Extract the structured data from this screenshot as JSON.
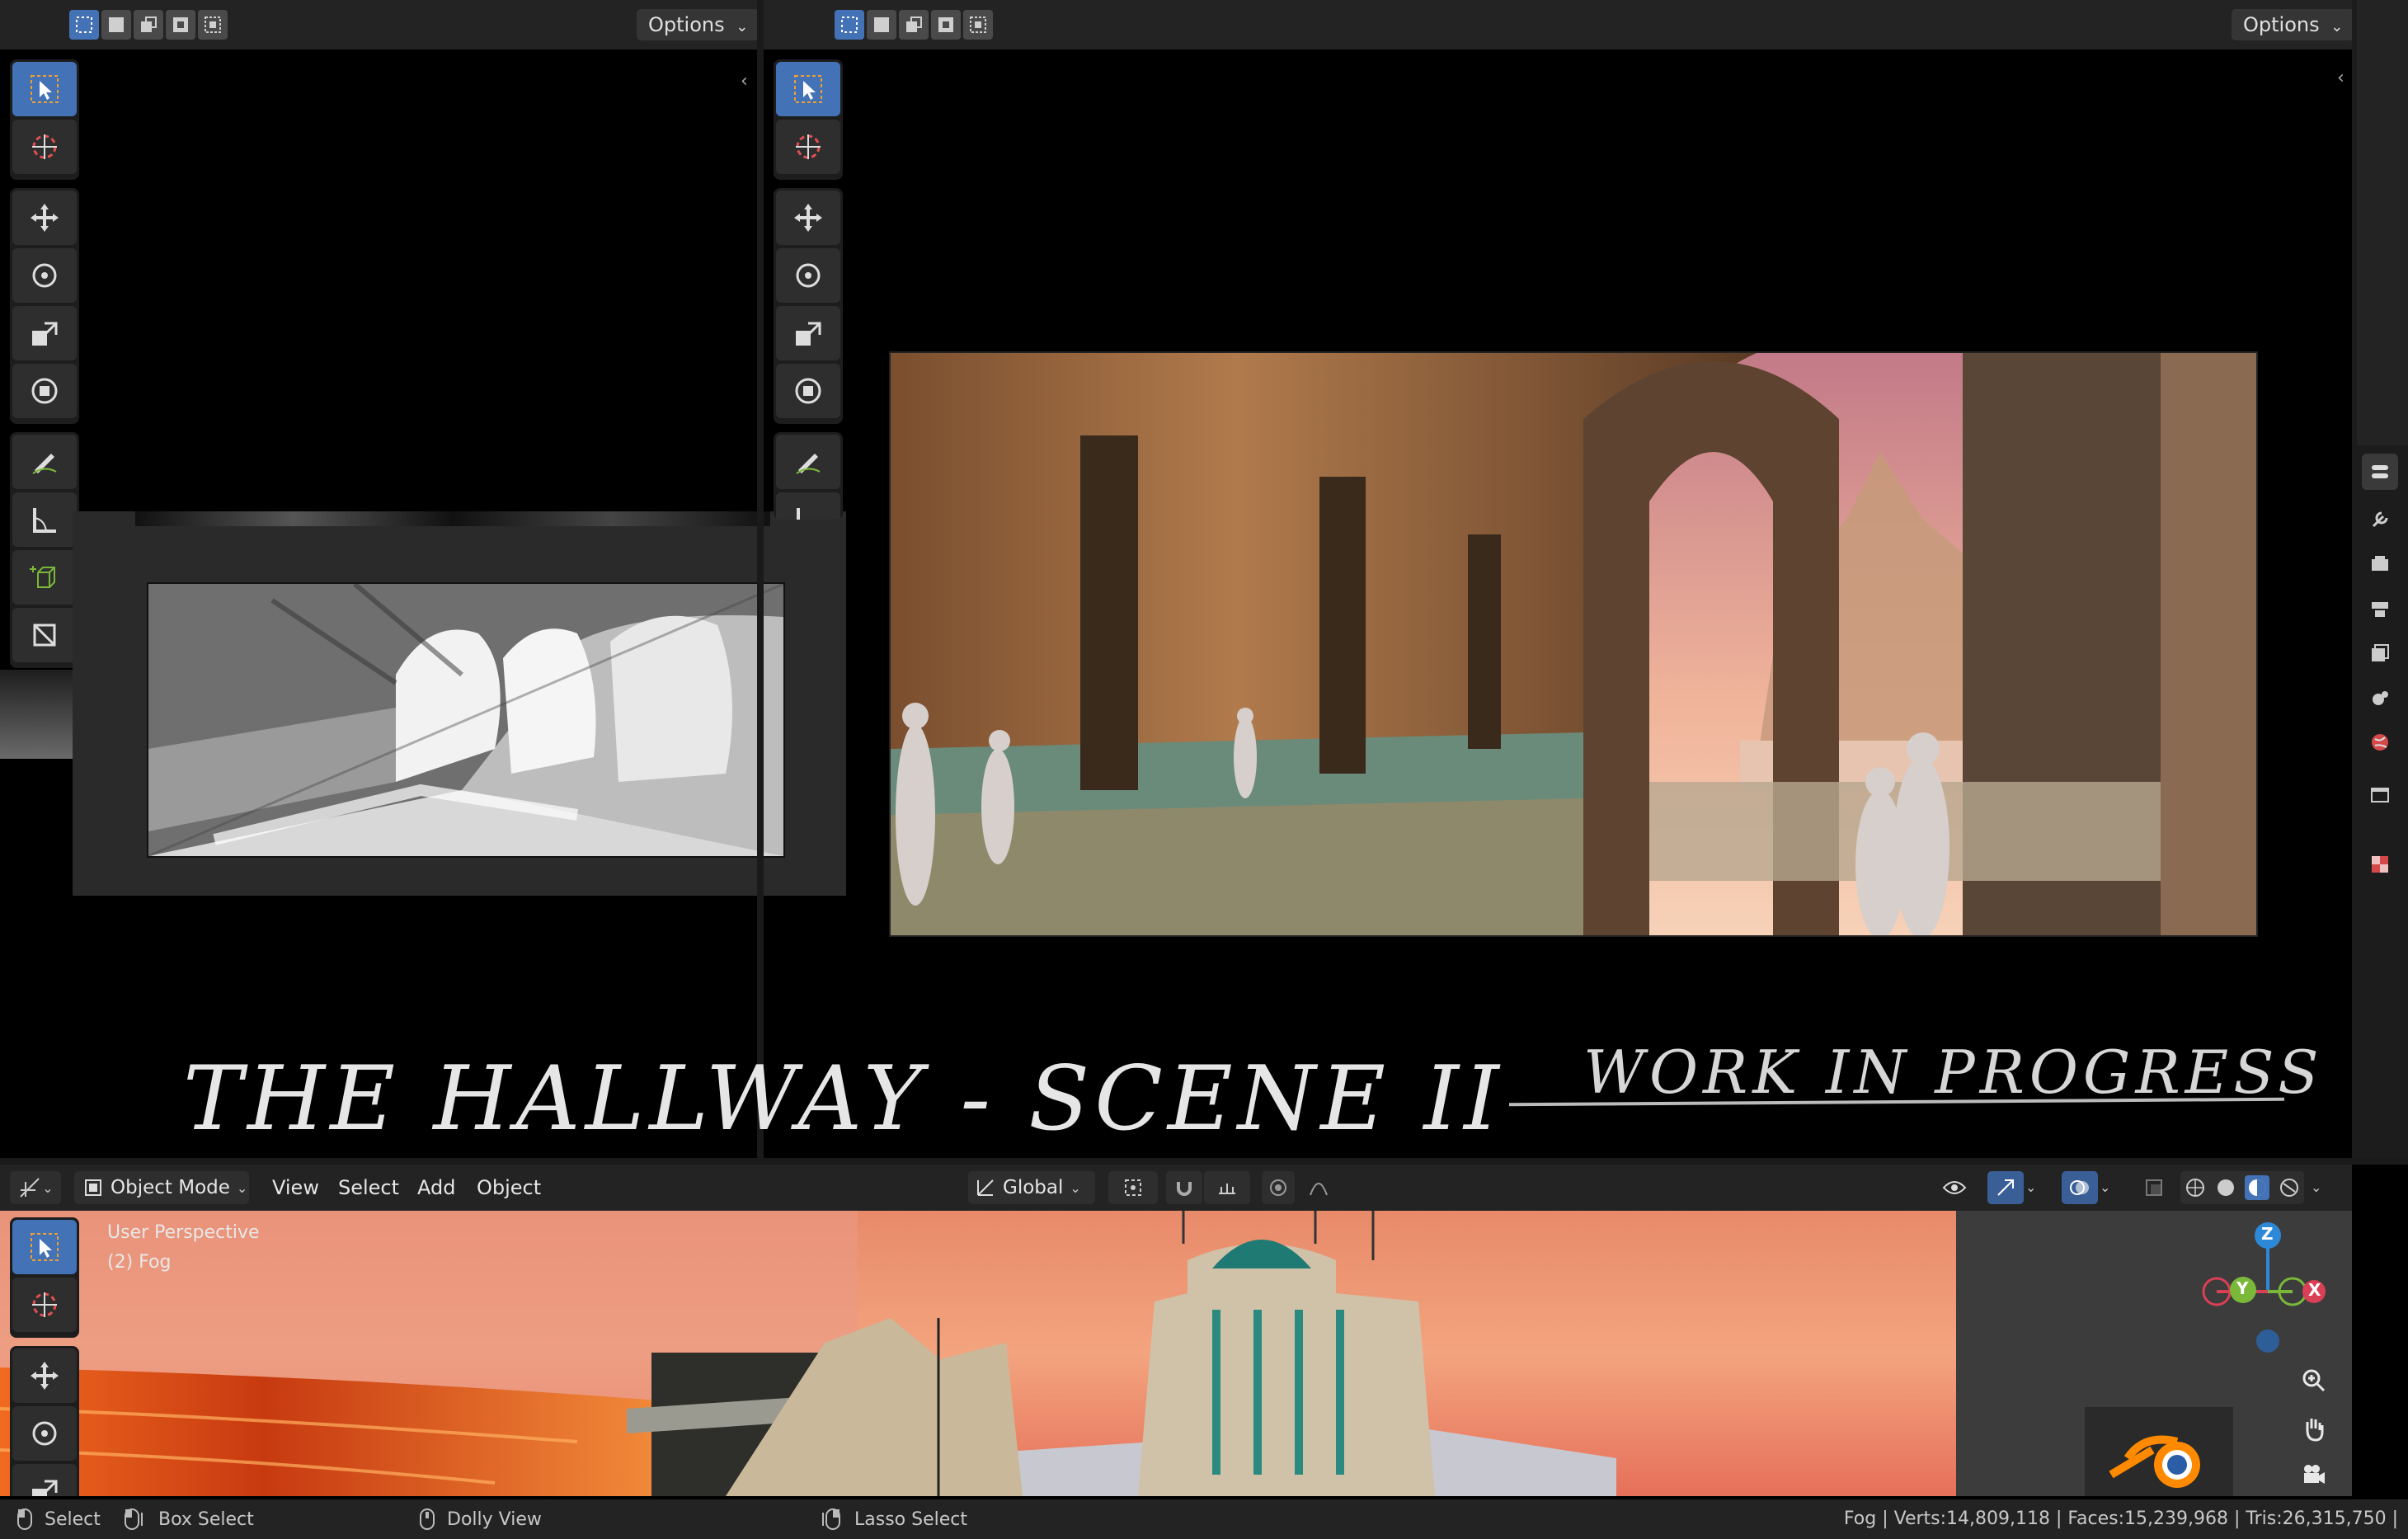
{
  "top_left_header": {
    "options_label": "Options"
  },
  "top_right_header": {
    "options_label": "Options"
  },
  "viewport_header": {
    "editor_icon": "editor-type-icon",
    "mode_label": "Object Mode",
    "menus": [
      "View",
      "Select",
      "Add",
      "Object"
    ],
    "transform_orientation": "Global"
  },
  "viewport_overlay": {
    "perspective_label": "User Perspective",
    "collection_label": "(2) Fog"
  },
  "gizmo": {
    "z": "Z",
    "y": "Y",
    "x": "X"
  },
  "handwritten": {
    "title": "THE HALLWAY - SCENE II",
    "subtitle": "WORK IN PROGRESS"
  },
  "status_bar": {
    "select": "Select",
    "box_select": "Box Select",
    "dolly_view": "Dolly View",
    "lasso_select": "Lasso Select",
    "stats": "Fog | Verts:14,809,118 | Faces:15,239,968 | Tris:26,315,750 |"
  },
  "colors": {
    "accent": "#4472b6",
    "header_bg": "#232323",
    "gizmo_x": "#d94055",
    "gizmo_y": "#7ab83a",
    "gizmo_z": "#2e88d8"
  }
}
